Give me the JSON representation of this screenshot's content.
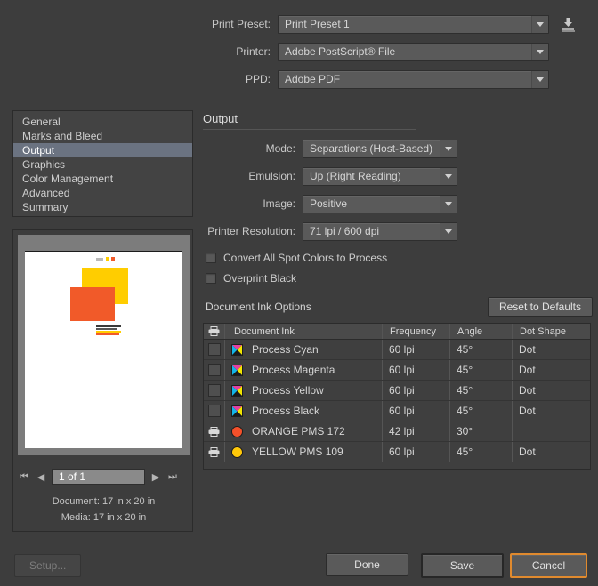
{
  "top": {
    "rows": [
      {
        "label": "Print Preset:",
        "value": "Print Preset 1"
      },
      {
        "label": "Printer:",
        "value": "Adobe PostScript® File"
      },
      {
        "label": "PPD:",
        "value": "Adobe PDF"
      }
    ],
    "save_preset_icon": "save-preset-icon"
  },
  "sidebar": {
    "items": [
      {
        "label": "General",
        "selected": false
      },
      {
        "label": "Marks and Bleed",
        "selected": false
      },
      {
        "label": "Output",
        "selected": true
      },
      {
        "label": "Graphics",
        "selected": false
      },
      {
        "label": "Color Management",
        "selected": false
      },
      {
        "label": "Advanced",
        "selected": false
      },
      {
        "label": "Summary",
        "selected": false
      }
    ]
  },
  "preview": {
    "nav": {
      "first": "⏮",
      "prev": "◀",
      "page_value": "1 of 1",
      "next": "▶",
      "last": "⏭"
    },
    "document_size": "Document: 17 in x 20 in",
    "media_size": "Media: 17 in x 20 in",
    "colors": {
      "yellow": "#FFCD00",
      "orange": "#F15A29"
    }
  },
  "output": {
    "section_title": "Output",
    "fields": [
      {
        "label": "Mode:",
        "value": "Separations (Host-Based)"
      },
      {
        "label": "Emulsion:",
        "value": "Up (Right Reading)"
      },
      {
        "label": "Image:",
        "value": "Positive"
      },
      {
        "label": "Printer Resolution:",
        "value": "71 lpi / 600 dpi"
      }
    ],
    "checkboxes": [
      {
        "label": "Convert All Spot Colors to Process",
        "checked": false
      },
      {
        "label": "Overprint Black",
        "checked": false
      }
    ],
    "ink_options_label": "Document Ink Options",
    "reset_button": "Reset to Defaults",
    "table": {
      "headers": {
        "print": "printer-icon",
        "ink": "Document Ink",
        "frequency": "Frequency",
        "angle": "Angle",
        "dot_shape": "Dot Shape"
      },
      "rows": [
        {
          "print": false,
          "swatch": "cmyk",
          "color": "",
          "ink": "Process Cyan",
          "frequency": "60 lpi",
          "angle": "45°",
          "dot_shape": "Dot"
        },
        {
          "print": false,
          "swatch": "cmyk",
          "color": "",
          "ink": "Process Magenta",
          "frequency": "60 lpi",
          "angle": "45°",
          "dot_shape": "Dot"
        },
        {
          "print": false,
          "swatch": "cmyk",
          "color": "",
          "ink": "Process Yellow",
          "frequency": "60 lpi",
          "angle": "45°",
          "dot_shape": "Dot"
        },
        {
          "print": false,
          "swatch": "cmyk",
          "color": "",
          "ink": "Process Black",
          "frequency": "60 lpi",
          "angle": "45°",
          "dot_shape": "Dot"
        },
        {
          "print": true,
          "swatch": "spot",
          "color": "#F4502A",
          "ink": "ORANGE PMS 172",
          "frequency": "42 lpi",
          "angle": "30°",
          "dot_shape": ""
        },
        {
          "print": true,
          "swatch": "spot",
          "color": "#FFC809",
          "ink": "YELLOW PMS 109",
          "frequency": "60 lpi",
          "angle": "45°",
          "dot_shape": "Dot"
        }
      ]
    }
  },
  "footer": {
    "setup": "Setup...",
    "done": "Done",
    "save": "Save",
    "cancel": "Cancel",
    "focus_color": "#e08a2e"
  }
}
